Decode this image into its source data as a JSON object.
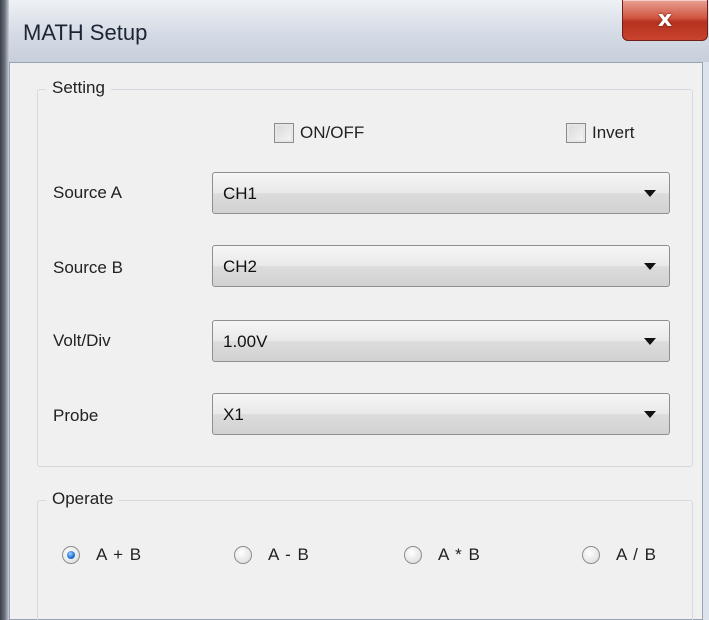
{
  "window": {
    "title": "MATH Setup",
    "close_glyph": "x"
  },
  "setting": {
    "legend": "Setting",
    "onoff_label": "ON/OFF",
    "invert_label": "Invert",
    "source_a": {
      "label": "Source A",
      "value": "CH1"
    },
    "source_b": {
      "label": "Source B",
      "value": "CH2"
    },
    "volt_div": {
      "label": "Volt/Div",
      "value": "1.00V"
    },
    "probe": {
      "label": "Probe",
      "value": "X1"
    }
  },
  "operate": {
    "legend": "Operate",
    "options": [
      {
        "label": "A + B",
        "checked": true
      },
      {
        "label": "A - B",
        "checked": false
      },
      {
        "label": "A * B",
        "checked": false
      },
      {
        "label": "A / B",
        "checked": false
      }
    ]
  }
}
